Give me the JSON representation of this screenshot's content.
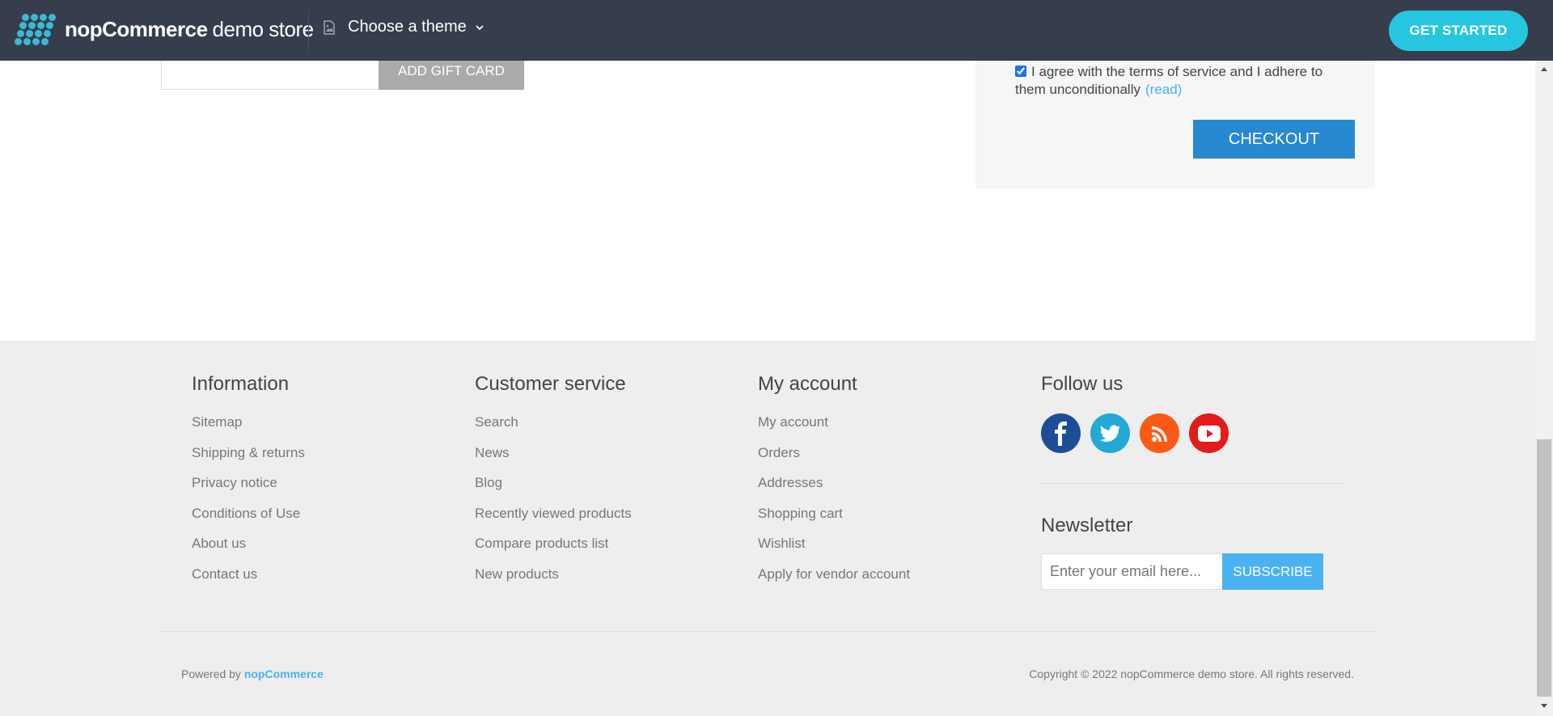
{
  "topbar": {
    "logo_bold": "nopCommerce",
    "logo_rest": "demo store",
    "theme_label": "Choose a theme",
    "get_started": "GET STARTED"
  },
  "gift_card": {
    "button": "ADD GIFT CARD",
    "input_value": ""
  },
  "totals": {
    "terms_text": "I agree with the terms of service and I adhere to them unconditionally",
    "terms_checked": true,
    "read_link": "(read)",
    "checkout": "CHECKOUT"
  },
  "footer": {
    "information": {
      "title": "Information",
      "items": [
        "Sitemap",
        "Shipping & returns",
        "Privacy notice",
        "Conditions of Use",
        "About us",
        "Contact us"
      ]
    },
    "customer_service": {
      "title": "Customer service",
      "items": [
        "Search",
        "News",
        "Blog",
        "Recently viewed products",
        "Compare products list",
        "New products"
      ]
    },
    "my_account": {
      "title": "My account",
      "items": [
        "My account",
        "Orders",
        "Addresses",
        "Shopping cart",
        "Wishlist",
        "Apply for vendor account"
      ]
    },
    "follow_us": {
      "title": "Follow us",
      "icons": [
        "facebook-icon",
        "twitter-icon",
        "rss-icon",
        "youtube-icon"
      ]
    },
    "newsletter": {
      "title": "Newsletter",
      "placeholder": "Enter your email here...",
      "button": "SUBSCRIBE"
    },
    "powered_by_prefix": "Powered by",
    "powered_by_link": "nopCommerce",
    "copyright": "Copyright © 2022 nopCommerce demo store. All rights reserved."
  },
  "colors": {
    "topbar_bg": "#363d4c",
    "accent_cyan": "#26c6e0",
    "checkout_blue": "#2789d0",
    "link_blue": "#4ab2f1",
    "footer_bg": "#eeeeee"
  }
}
